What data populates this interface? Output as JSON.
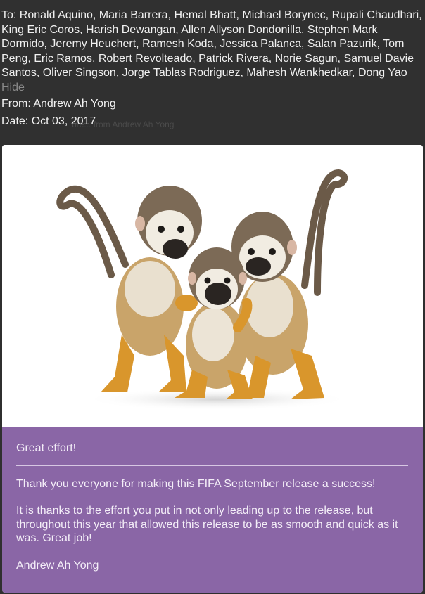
{
  "header": {
    "to_label": "To:",
    "recipients_text": "Ronald Aquino, Maria Barrera, Hemal Bhatt, Michael Borynec, Rupali Chaudhari, King Eric Coros, Harish Dewangan, Allen Allyson Dondonilla, Stephen Mark Dormido, Jeremy Heuchert, Ramesh Koda, Jessica Palanca, Salan Pazurik, Tom Peng, Eric Ramos, Robert Revolteado, Patrick Rivera, Norie Sagun, Samuel Davie Santos, Oliver Singson, Jorge Tablas Rodriguez, Mahesh Wankhedkar, Dong Yao",
    "hide_label": "Hide",
    "from_text": "From: Andrew Ah Yong",
    "date_text": "Date: Oct 03, 2017",
    "ghost_text": "bre... from Andrew Ah Yong"
  },
  "message": {
    "greeting": "Great effort!",
    "paragraph_1": "Thank you everyone for making this FIFA September release a success!",
    "paragraph_2": "It is thanks to the effort you put in not only leading up to the release, but throughout this year that allowed this release to be as smooth and quick as it was. Great job!",
    "signature": "Andrew Ah Yong"
  },
  "colors": {
    "header_bg": "#303030",
    "card_bg": "#ffffff",
    "message_bg": "#8a66a6",
    "hide_color": "#8a8a8a"
  },
  "image": {
    "subject": "three-squirrel-monkeys-photo"
  }
}
